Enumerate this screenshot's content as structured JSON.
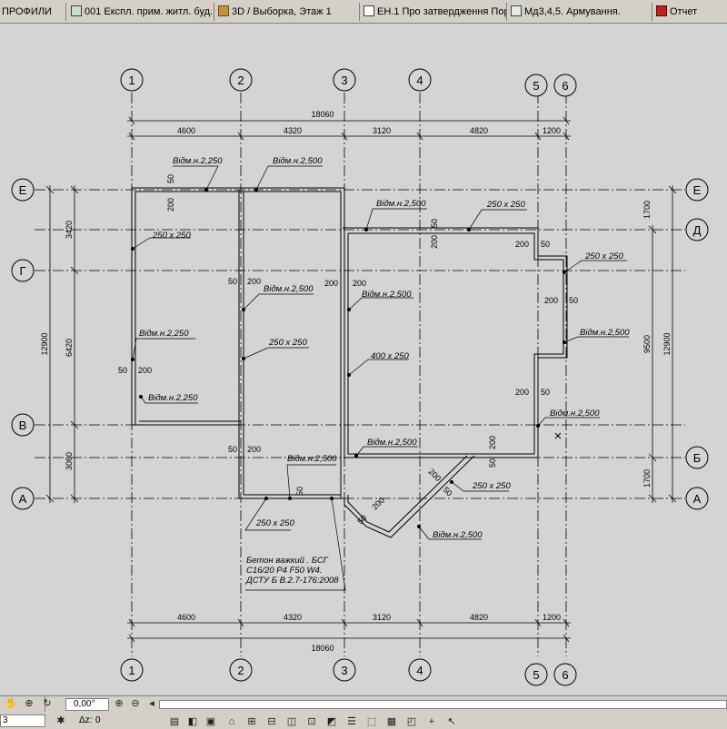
{
  "tabs": [
    {
      "label": "ПРОФИЛИ",
      "icon": "document-icon"
    },
    {
      "label": "001 Експл. прим. житл. буд....",
      "icon": "floor-plan-icon"
    },
    {
      "label": "3D / Выборка, Этаж 1",
      "icon": "3d-view-icon"
    },
    {
      "label": "ЕН.1 Про затвердження Пор...",
      "icon": "layout-icon"
    },
    {
      "label": "Мд3,4,5. Армування.",
      "icon": "detail-icon"
    },
    {
      "label": "Отчет",
      "icon": "report-icon"
    }
  ],
  "grid": {
    "columns": [
      "1",
      "2",
      "3",
      "4",
      "5",
      "6"
    ],
    "rows": [
      "Е",
      "Д",
      "Г",
      "В",
      "Б",
      "А"
    ]
  },
  "dimensions": {
    "total_horizontal": "18060",
    "spans_horizontal": [
      "4600",
      "4320",
      "3120",
      "4820",
      "1200"
    ],
    "total_horizontal_bottom": "18060",
    "spans_horizontal_bottom": [
      "4600",
      "4320",
      "3120",
      "4820",
      "1200"
    ],
    "left_total": "12900",
    "left_spans": [
      "3420",
      "6420",
      "3060"
    ],
    "right_total": "12900",
    "right_mid": "9500",
    "right_top": "1700",
    "right_bottom": "1700"
  },
  "annotations": {
    "elev_250": "Відм.н.2,250",
    "elev_500": "Відм.н.2,500",
    "section_250": "250 x 250",
    "section_400": "400 x 250",
    "n50": "50",
    "n200": "200",
    "concrete_1": "Бетон важкий . БСГ",
    "concrete_2": "С16/20 Р4 F50 W4.",
    "concrete_3": "ДСТУ Б В.2.7-176:2008"
  },
  "status": {
    "field_1": "3",
    "field_2": "0",
    "angle": "0,00°",
    "dz_label": "Δz:",
    "dz_value": "0"
  }
}
